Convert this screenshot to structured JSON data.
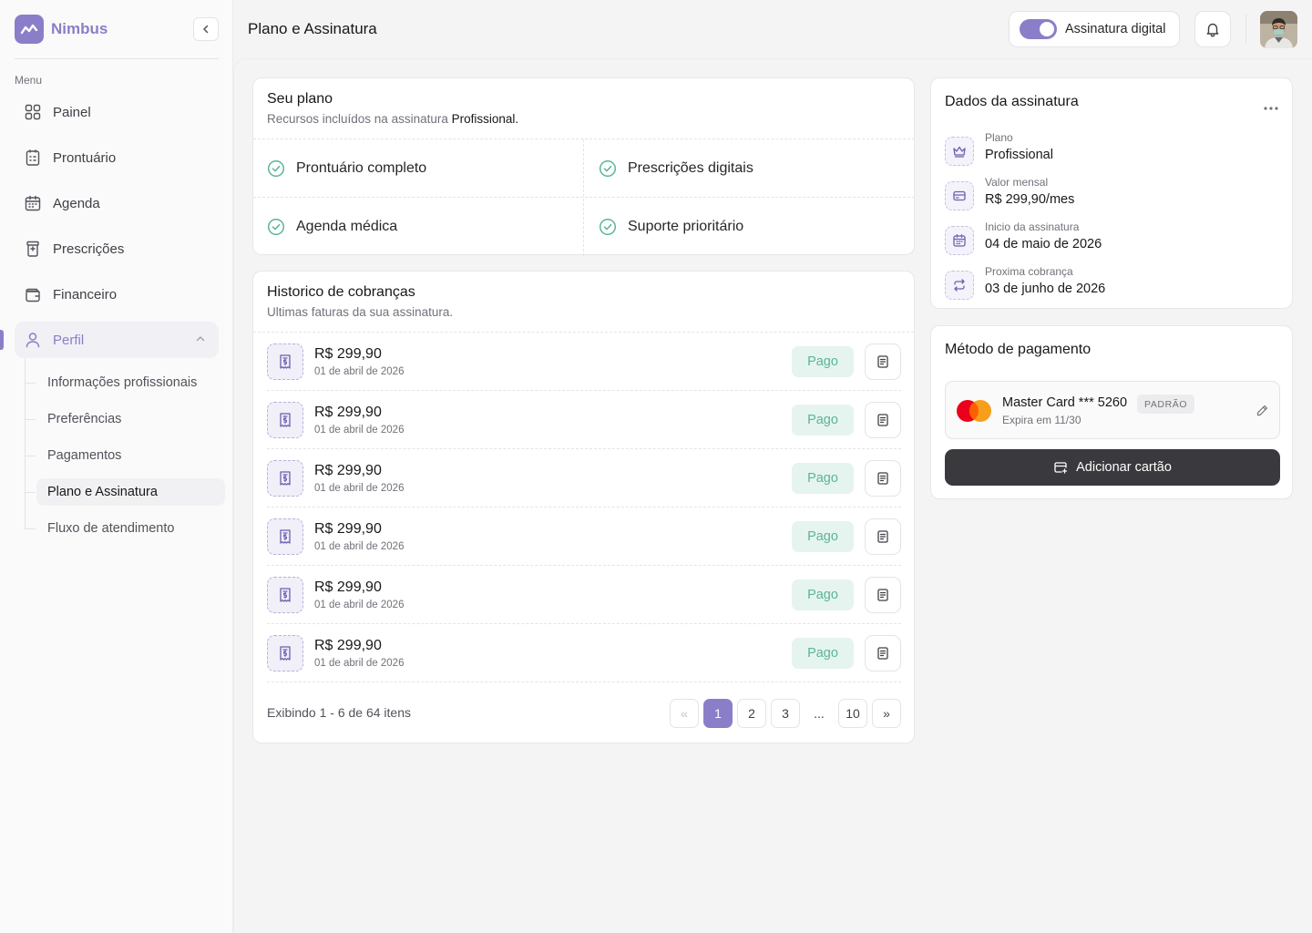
{
  "brand": {
    "name": "Nimbus"
  },
  "sidebar": {
    "menu_label": "Menu",
    "items": [
      {
        "label": "Painel",
        "icon": "grid-icon"
      },
      {
        "label": "Prontuário",
        "icon": "clipboard-icon"
      },
      {
        "label": "Agenda",
        "icon": "calendar-icon"
      },
      {
        "label": "Prescrições",
        "icon": "prescription-icon"
      },
      {
        "label": "Financeiro",
        "icon": "wallet-icon"
      },
      {
        "label": "Perfil",
        "icon": "user-icon"
      }
    ],
    "profile_sub": [
      "Informações profissionais",
      "Preferências",
      "Pagamentos",
      "Plano e Assinatura",
      "Fluxo de atendimento"
    ]
  },
  "header": {
    "title": "Plano e Assinatura",
    "toggle_label": "Assinatura digital"
  },
  "plan": {
    "title": "Seu plano",
    "subtitle": "Recursos incluídos na assinatura",
    "plan_name": "Profissional.",
    "features": [
      "Prontuário completo",
      "Prescrições digitais",
      "Agenda médica",
      "Suporte prioritário"
    ]
  },
  "history": {
    "title": "Historico de cobranças",
    "subtitle": "Ultimas faturas da sua assinatura.",
    "rows": [
      {
        "amount": "R$ 299,90",
        "date": "01 de abril de 2026",
        "status": "Pago"
      },
      {
        "amount": "R$ 299,90",
        "date": "01 de abril de 2026",
        "status": "Pago"
      },
      {
        "amount": "R$ 299,90",
        "date": "01 de abril de 2026",
        "status": "Pago"
      },
      {
        "amount": "R$ 299,90",
        "date": "01 de abril de 2026",
        "status": "Pago"
      },
      {
        "amount": "R$ 299,90",
        "date": "01 de abril de 2026",
        "status": "Pago"
      },
      {
        "amount": "R$ 299,90",
        "date": "01 de abril de 2026",
        "status": "Pago"
      }
    ],
    "pager_info": "Exibindo 1 - 6 de 64 itens",
    "pages": [
      "1",
      "2",
      "3",
      "...",
      "10"
    ],
    "prev": "«",
    "next": "»"
  },
  "subscription": {
    "title": "Dados da assinatura",
    "fields": [
      {
        "label": "Plano",
        "value": "Profissional",
        "icon": "crown-icon"
      },
      {
        "label": "Valor mensal",
        "value": "R$ 299,90/mes",
        "icon": "credit-card-icon"
      },
      {
        "label": "Inicio da assinatura",
        "value": "04 de maio de 2026",
        "icon": "calendar-icon"
      },
      {
        "label": "Proxima cobrança",
        "value": "03 de junho de 2026",
        "icon": "repeat-icon"
      }
    ]
  },
  "payment": {
    "title": "Método de pagamento",
    "card_name": "Master Card *** 5260",
    "badge": "PADRÃO",
    "expiry": "Expira em 11/30",
    "add_button": "Adicionar cartão"
  },
  "colors": {
    "accent": "#8b7ec8",
    "paid_bg": "#e6f4ef",
    "paid_text": "#5ab596",
    "dark_button": "#3a3a3e"
  }
}
